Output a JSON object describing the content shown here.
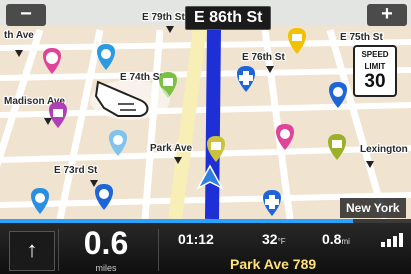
{
  "map": {
    "top_street": "E 86th St",
    "labels": {
      "east_ave": "th Ave",
      "e79": "E 79th St",
      "e76": "E 76th St",
      "e75": "E 75th St",
      "madison": "Madison Ave",
      "park": "Park Ave",
      "lexington": "Lexington",
      "e73": "E 73rd St",
      "e74": "E 74th St"
    },
    "city": "New York",
    "zoom_out": "−",
    "zoom_in": "+"
  },
  "speed_limit": {
    "title_1": "SPEED",
    "title_2": "LIMIT",
    "value": "30"
  },
  "panel": {
    "turn_arrow": "↑",
    "distance": "0.6",
    "distance_unit": "miles",
    "time": "01:12",
    "temperature": "32",
    "temperature_unit": "°F",
    "remaining": "0.8",
    "remaining_unit": "mi",
    "next_street": "Park Ave 789",
    "route_progress": 0.86
  },
  "colors": {
    "route": "#1f2fd6",
    "accent": "#2aa3ff"
  }
}
